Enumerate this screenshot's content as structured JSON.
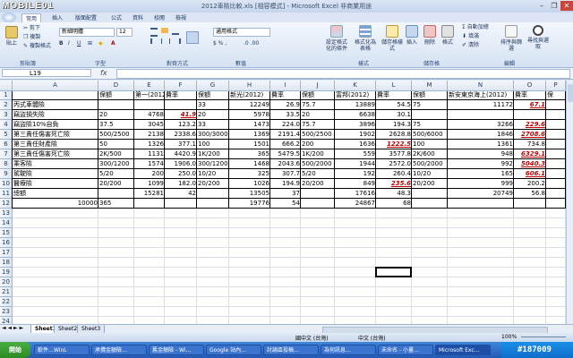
{
  "window": {
    "logo": "MOBILE01",
    "title": "2012車險比較.xls [相容模式] - Microsoft Excel 非商業用途",
    "minimize_icon": "–",
    "restore_icon": "❐",
    "close_icon": "✕"
  },
  "menu": {
    "items": [
      "常用",
      "插入",
      "版面配置",
      "公式",
      "資料",
      "校閱",
      "檢視"
    ]
  },
  "ribbon": {
    "clipboard": {
      "paste": "貼上",
      "cut": "剪下",
      "copy": "複製",
      "format_painter": "複製格式",
      "label": "剪貼簿"
    },
    "font": {
      "name": "新細明體",
      "size": "12",
      "label": "字型"
    },
    "alignment": {
      "label": "對齊方式"
    },
    "number": {
      "format": "通用格式",
      "label": "數值"
    },
    "styles": {
      "conditional": "設定格式化的條件",
      "table": "格式化為表格",
      "cell": "儲存格樣式",
      "label": "樣式"
    },
    "cells": {
      "insert": "插入",
      "delete": "刪除",
      "format": "格式",
      "label": "儲存格"
    },
    "editing": {
      "autosum": "自動加總",
      "fill": "填滿",
      "clear": "清除",
      "sort": "排序與篩選",
      "find": "尋找與選取",
      "label": "編輯"
    }
  },
  "formula_bar": {
    "name_box": "L19",
    "fx": "fx",
    "value": ""
  },
  "columns": [
    "A",
    "D",
    "E",
    "F",
    "G",
    "H",
    "I",
    "J",
    "K",
    "L",
    "M",
    "N",
    "O",
    "P"
  ],
  "rows": [
    "1",
    "2",
    "3",
    "4",
    "5",
    "6",
    "7",
    "8",
    "9",
    "10",
    "11",
    "12",
    "13",
    "14",
    "15",
    "16",
    "17",
    "18",
    "19",
    "20",
    "21",
    "22",
    "23",
    "24"
  ],
  "cells": {
    "r1": [
      "",
      "保額",
      "第一(2012)",
      "費率",
      "保額",
      "新光(2012)",
      "費率",
      "保額",
      "富邦(2012)",
      "費率",
      "保額",
      "新安東京海上(2012)",
      "費率",
      "保"
    ],
    "r2": [
      "丙式車體險",
      "",
      "",
      "",
      "33",
      "12249",
      "26.9",
      "75.7",
      "13889",
      "54.5",
      "75",
      "11172",
      "67.1",
      ""
    ],
    "r3": [
      "竊盜損失險",
      "20",
      "4768",
      "41.9",
      "20",
      "5978",
      "33.5",
      "20",
      "6638",
      "30.1",
      "",
      "",
      "",
      ""
    ],
    "r4": [
      "竊盜險10%自負",
      "37.5",
      "3045",
      "123.2",
      "33",
      "1473",
      "224.0",
      "75.7",
      "3896",
      "194.3",
      "75",
      "3266",
      "229.6",
      ""
    ],
    "r5": [
      "第三責任傷害死亡險",
      "500/2500",
      "2138",
      "2338.6",
      "300/3000",
      "1369",
      "2191.4",
      "500/2500",
      "1902",
      "2628.8",
      "500/6000",
      "1846",
      "2708.6",
      ""
    ],
    "r6": [
      "第三責任財產險",
      "50",
      "1326",
      "377.1",
      "100",
      "1501",
      "666.2",
      "200",
      "1636",
      "1222.5",
      "100",
      "1361",
      "734.8",
      ""
    ],
    "r7": [
      "第三責任傷害死亡險",
      "2K/500",
      "1131",
      "4420.9",
      "1K/200",
      "365",
      "5479.5",
      "1K/200",
      "559",
      "3577.8",
      "2K/600",
      "948",
      "6329.1",
      ""
    ],
    "r8": [
      "乘客險",
      "300/1200",
      "1574",
      "1906.0",
      "300/1200",
      "1468",
      "2043.6",
      "500/2000",
      "1944",
      "2572.0",
      "500/2000",
      "992",
      "5040.3",
      ""
    ],
    "r9": [
      "駕駛險",
      "5/20",
      "200",
      "250.0",
      "10/20",
      "325",
      "307.7",
      "5/20",
      "192",
      "260.4",
      "10/20",
      "165",
      "606.1",
      ""
    ],
    "r10": [
      "醫療險",
      "20/200",
      "1099",
      "182.0",
      "20/200",
      "1026",
      "194.9",
      "20/200",
      "849",
      "235.6",
      "20/200",
      "999",
      "200.2",
      ""
    ],
    "r11": [
      "總額",
      "",
      "15281",
      "42",
      "",
      "13505",
      "37",
      "",
      "17616",
      "48.3",
      "",
      "20749",
      "56.8",
      ""
    ],
    "r12": [
      "10000",
      "365",
      "",
      "",
      "",
      "19776",
      "54",
      "",
      "24867",
      "68",
      "",
      "",
      "",
      ""
    ]
  },
  "highlight_red": [
    "F3",
    "O2",
    "O4",
    "O5",
    "L6",
    "O7",
    "O8",
    "O9",
    "L10"
  ],
  "sheet_tabs": [
    "Sheet1",
    "Sheet2",
    "Sheet3"
  ],
  "status": {
    "ime": "國中文 (台灣)",
    "ime2": "中文 (台灣)",
    "zoom": "100%"
  },
  "taskbar": {
    "start": "開始",
    "tasks": [
      "軟件…WinL",
      "承攬金額險…",
      "舊金額險 - Wi…",
      "Google 站內…",
      "討論區投稿…",
      "為何訊息…",
      "未命名 - 小畫…",
      "Microsoft Exc…"
    ],
    "watermark": "#187009"
  },
  "colors": {
    "accent": "#2459b6",
    "red_value": "#c00000",
    "selection": "#000000"
  }
}
